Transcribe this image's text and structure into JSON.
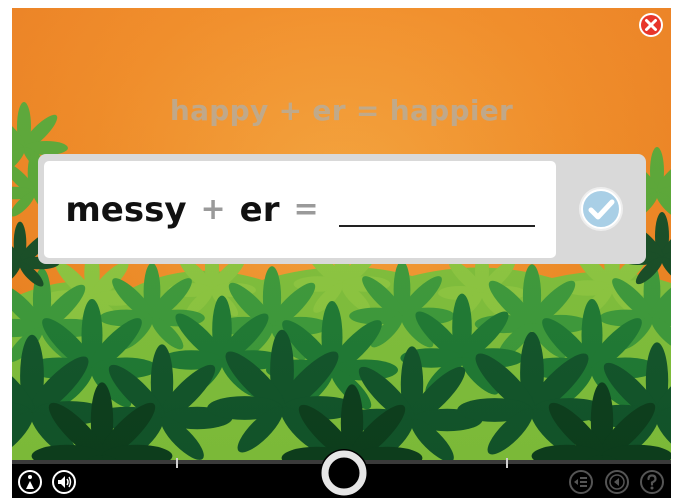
{
  "example": {
    "word": "happy",
    "plus": "+",
    "suffix": "er",
    "equals": "=",
    "result": "happier"
  },
  "question": {
    "word": "messy",
    "plus": "+",
    "suffix": "er",
    "equals": "=",
    "answer_value": ""
  },
  "icons": {
    "close": "close-icon",
    "check": "checkmark-icon",
    "info": "info-icon",
    "audio": "speaker-icon",
    "list": "list-icon",
    "back": "back-icon",
    "help": "help-icon",
    "hub": "ring-icon"
  },
  "colors": {
    "background": "#f08a24",
    "close": "#e8362b",
    "check": "#a9cfe6",
    "foliage_light": "#8cc63f",
    "foliage_dark": "#0d4a1f"
  }
}
